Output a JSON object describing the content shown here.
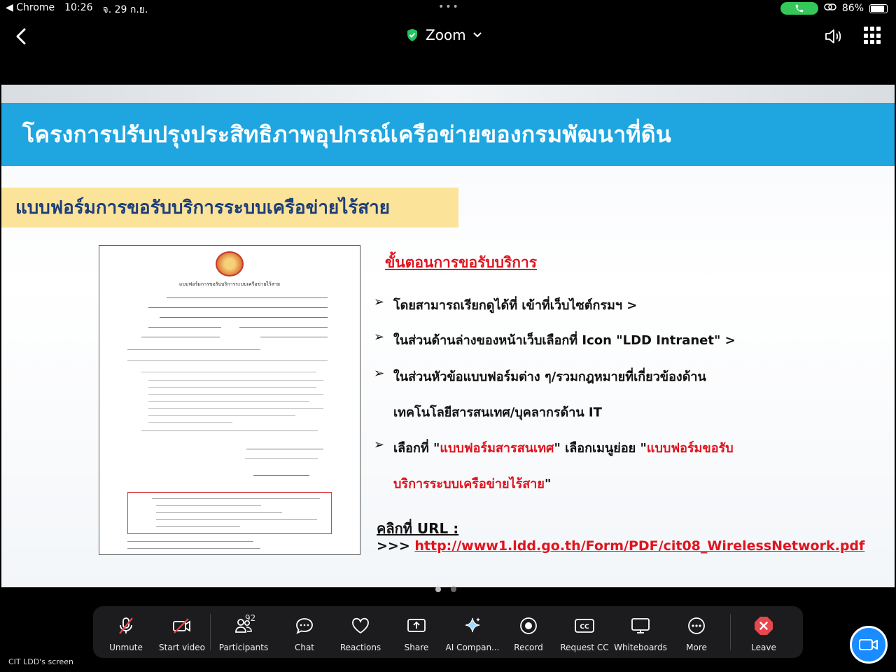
{
  "status_bar": {
    "back_app": "◀ Chrome",
    "time": "10:26",
    "date": "จ. 29 ก.ย.",
    "battery": "86%",
    "battery_level": 0.86
  },
  "header": {
    "app_title": "Zoom"
  },
  "slide": {
    "title": "โครงการปรับปรุงประสิทธิภาพอุปกรณ์เครือข่ายของกรมพัฒนาที่ดิน",
    "subtitle": "แบบฟอร์มการขอรับบริการระบบเครือข่ายไร้สาย",
    "form_heading": "แบบฟอร์มการขอรับบริการระบบเครือข่ายไร้สาย",
    "steps_title": "ขั้นตอนการขอรับบริการ",
    "steps": {
      "s1": "โดยสามารถเรียกดูได้ที่ เข้าที่เว็บไซต์กรมฯ >",
      "s2": "ในส่วนด้านล่างของหน้าเว็บเลือกที่ Icon \"LDD Intranet\" >",
      "s3a": "ในส่วนหัวข้อแบบฟอร์มต่าง ๆ/รวมกฎหมายที่เกี่ยวข้องด้าน",
      "s3b": "เทคโนโลยีสารสนเทศ/บุคลากรด้าน IT",
      "s4_pre": "เลือกที่ \"",
      "s4_red1": "แบบฟอร์มสารสนเทศ",
      "s4_mid": "\" เลือกเมนูย่อย \"",
      "s4_red2": "แบบฟอร์มขอรับ",
      "s4b_red": "บริการระบบเครือข่ายไร้สาย",
      "s4b_end": "\""
    },
    "url_label": "คลิกที่ URL :",
    "url_prefix": ">>>",
    "url": "http://www1.ldd.go.th/Form/PDF/cit08_WirelessNetwork.pdf"
  },
  "toolbar": {
    "unmute": "Unmute",
    "start_video": "Start video",
    "participants": "Participants",
    "participants_count": "92",
    "chat": "Chat",
    "reactions": "Reactions",
    "share": "Share",
    "ai_companion": "AI Compan...",
    "record": "Record",
    "request_cc": "Request CC",
    "whiteboards": "Whiteboards",
    "more": "More",
    "leave": "Leave"
  },
  "footer": {
    "screen_label": "CIT LDD's screen"
  },
  "colors": {
    "title_band": "#1fa6e0",
    "subtitle_band": "#fbe39a",
    "accent_red": "#e0141e",
    "call_green": "#34c759",
    "leave_red": "#e5484d",
    "fab_blue": "#1a8cff"
  }
}
